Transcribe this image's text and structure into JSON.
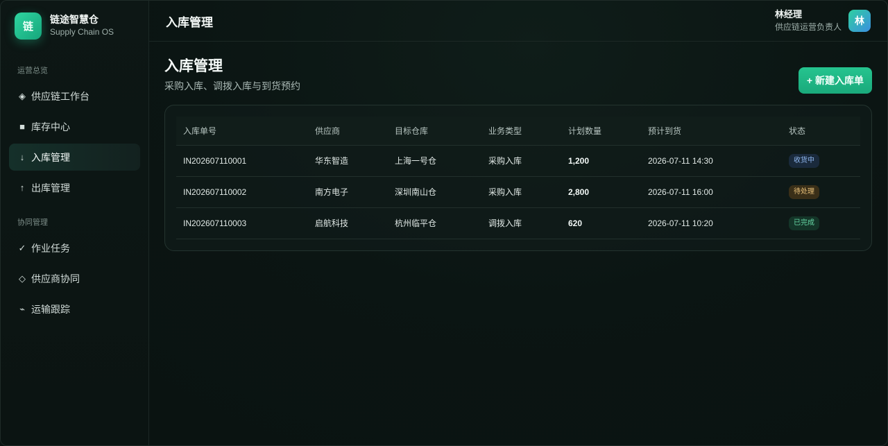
{
  "brand": {
    "logo": "链",
    "name": "链途智慧仓",
    "subtitle": "Supply Chain OS"
  },
  "sidebar": {
    "groups": [
      {
        "label": "运营总览"
      },
      {
        "label": "协同管理"
      }
    ],
    "items": [
      {
        "icon": "◈",
        "label": "供应链工作台"
      },
      {
        "icon": "■",
        "label": "库存中心"
      },
      {
        "icon": "↓",
        "label": "入库管理",
        "active": true
      },
      {
        "icon": "↑",
        "label": "出库管理"
      },
      {
        "icon": "✓",
        "label": "作业任务"
      },
      {
        "icon": "◇",
        "label": "供应商协同"
      },
      {
        "icon": "⌁",
        "label": "运输跟踪"
      }
    ]
  },
  "topbar": {
    "title": "入库管理"
  },
  "user": {
    "name": "林经理",
    "role": "供应链运营负责人",
    "avatar": "林"
  },
  "page": {
    "title": "入库管理",
    "subtitle": "采购入库、调拨入库与到货预约",
    "new_button": "+ 新建入库单"
  },
  "table": {
    "columns": [
      "入库单号",
      "供应商",
      "目标仓库",
      "业务类型",
      "计划数量",
      "预计到货",
      "状态"
    ],
    "rows": [
      {
        "id": "IN202607110001",
        "supplier": "华东智造",
        "warehouse": "上海一号仓",
        "type": "采购入库",
        "qty": "1,200",
        "eta": "2026-07-11 14:30",
        "status": "收货中",
        "status_color": "#8fb7ee"
      },
      {
        "id": "IN202607110002",
        "supplier": "南方电子",
        "warehouse": "深圳南山仓",
        "type": "采购入库",
        "qty": "2,800",
        "eta": "2026-07-11 16:00",
        "status": "待处理",
        "status_color": "#e9c27a"
      },
      {
        "id": "IN202607110003",
        "supplier": "启航科技",
        "warehouse": "杭州临平仓",
        "type": "调拨入库",
        "qty": "620",
        "eta": "2026-07-11 10:20",
        "status": "已完成",
        "status_color": "#66d6a4"
      }
    ]
  },
  "colors": {
    "accent": "#22c08c",
    "background": "#0b1412"
  }
}
